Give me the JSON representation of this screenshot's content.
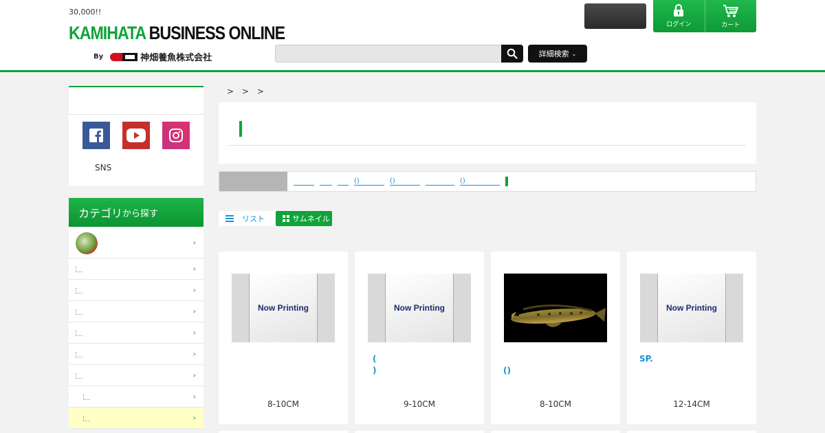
{
  "header": {
    "tagline": "30,000!!",
    "logo_green": "KAMIHATA",
    "logo_black": " BUSINESS ONLINE",
    "logo_by": "By",
    "logo_company": "神畑養魚株式会社",
    "search_placeholder": "",
    "advanced_search_label": "詳細検索",
    "gray_button_label": "",
    "login_label": "ログイン",
    "cart_label": "カート"
  },
  "sidebar": {
    "sns_heading": "",
    "sns_label": "SNS",
    "sns_icons": [
      "facebook-icon",
      "youtube-icon",
      "instagram-icon"
    ],
    "category_title_main": "カテゴリ",
    "category_title_small": "から探す",
    "category_items": [
      {
        "label": "",
        "type": "thumb"
      },
      {
        "label": "",
        "type": "sub"
      },
      {
        "label": "",
        "type": "sub"
      },
      {
        "label": "",
        "type": "sub"
      },
      {
        "label": "",
        "type": "sub"
      },
      {
        "label": "",
        "type": "sub"
      },
      {
        "label": "",
        "type": "sub"
      },
      {
        "label": "",
        "type": "subsub"
      },
      {
        "label": "",
        "type": "subsub",
        "highlighted": true
      }
    ]
  },
  "main": {
    "breadcrumb": "> > >",
    "page_title": "",
    "filter_label": "",
    "filter_links": [
      "",
      "",
      "",
      "()",
      "()",
      "",
      "()"
    ],
    "view_list_label": "リスト",
    "view_thumb_label": "サムネイル",
    "products": [
      {
        "image": "now-printing",
        "image_text": "Now Printing",
        "name": "",
        "size": "8-10CM"
      },
      {
        "image": "now-printing",
        "image_text": "Now Printing",
        "name": "(\n)",
        "size": "9-10CM"
      },
      {
        "image": "fish-photo",
        "image_text": "",
        "name": "()",
        "size": "8-10CM"
      },
      {
        "image": "now-printing",
        "image_text": "Now Printing",
        "name": "SP.",
        "size": "12-14CM"
      }
    ]
  },
  "colors": {
    "brand_green": "#0fa33a",
    "link_blue": "#1a8fd8",
    "highlight_yellow": "#ffffc6"
  }
}
